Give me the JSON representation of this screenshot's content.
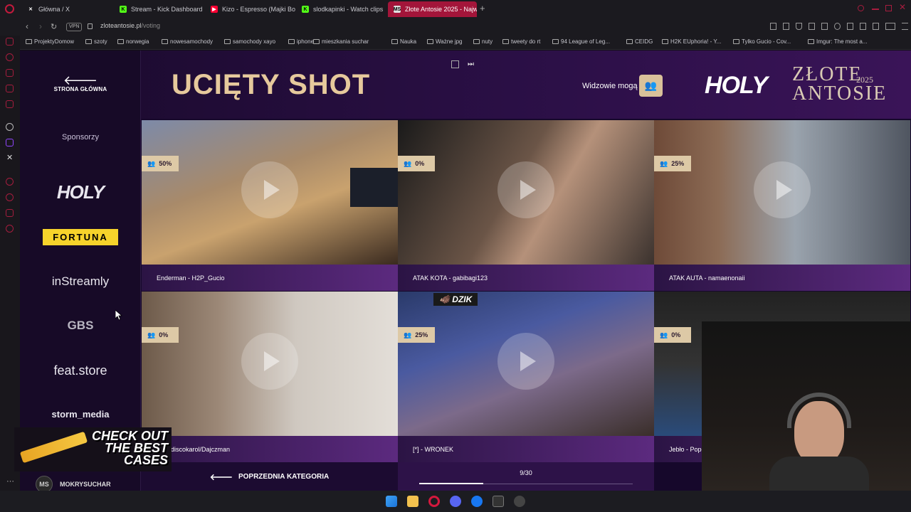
{
  "browser": {
    "tabs": [
      {
        "label": "Główna / X",
        "favicon": "X",
        "color": "#ffffff",
        "active": false
      },
      {
        "label": "Stream - Kick Dashboard",
        "favicon": "K",
        "color": "#53fc18",
        "active": false
      },
      {
        "label": "Kizo - Espresso (Majki Bo",
        "favicon": "▶",
        "color": "#ff0033",
        "active": false
      },
      {
        "label": "slodkapinki - Watch clips",
        "favicon": "K",
        "color": "#53fc18",
        "active": false
      },
      {
        "label": "Złote Antosie 2025 - Najw",
        "favicon": "MS",
        "color": "#e0e0e0",
        "active": true
      }
    ],
    "vpn_badge": "VPN",
    "url_domain": "zloteantosie.pl",
    "url_path": "/voting",
    "bookmarks": [
      "ProjektyDomow",
      "szoty",
      "norwegia",
      "nowesamochody",
      "samochody xayo",
      "iphone",
      "mieszkania suchar",
      "Nauka",
      "Ważne jpg",
      "nuty",
      "tweety do rt",
      "94 League of Leg...",
      "CEIDG",
      "H2K EUphoria! - Y...",
      "Tylko Gucio - Cov...",
      "Imgur: The most a..."
    ]
  },
  "header": {
    "home_label": "STRONA GŁÓWNA",
    "category_title": "UCIĘTY SHOT",
    "viewers_text": "Widzowie mogą",
    "brand_holy": "HOLY",
    "brand_line1": "ZŁOTE",
    "brand_line2": "ANTOSIE",
    "brand_year": "2025"
  },
  "sidebar": {
    "sponsors_label": "Sponsorzy",
    "sponsors": [
      "HOLY",
      "FORTUNA",
      "inStreamly",
      "GBS",
      "feat.store",
      "storm_media"
    ]
  },
  "clips": [
    {
      "title": "Enderman - H2P_Gucio",
      "percent": "50%"
    },
    {
      "title": "ATAK KOTA - gabibagi123",
      "percent": "0%"
    },
    {
      "title": "ATAK AUTA - namaenonaii",
      "percent": "25%"
    },
    {
      "title": "bie - discokarol/Dajczman",
      "percent": "0%"
    },
    {
      "title": "[*] - WRONEK",
      "percent": "25%"
    },
    {
      "title": "Jebło - Popo",
      "percent": "0%"
    }
  ],
  "clip_overlay_text": "DZIK",
  "navigation": {
    "prev_label": "POPRZEDNIA KATEGORIA",
    "progress_text": "9/30",
    "progress_fraction": 0.3
  },
  "overlay": {
    "promo_text": "CHECK OUT THE BEST CASES",
    "user_initials": "MS",
    "username": "MOKRYSUCHAR"
  }
}
